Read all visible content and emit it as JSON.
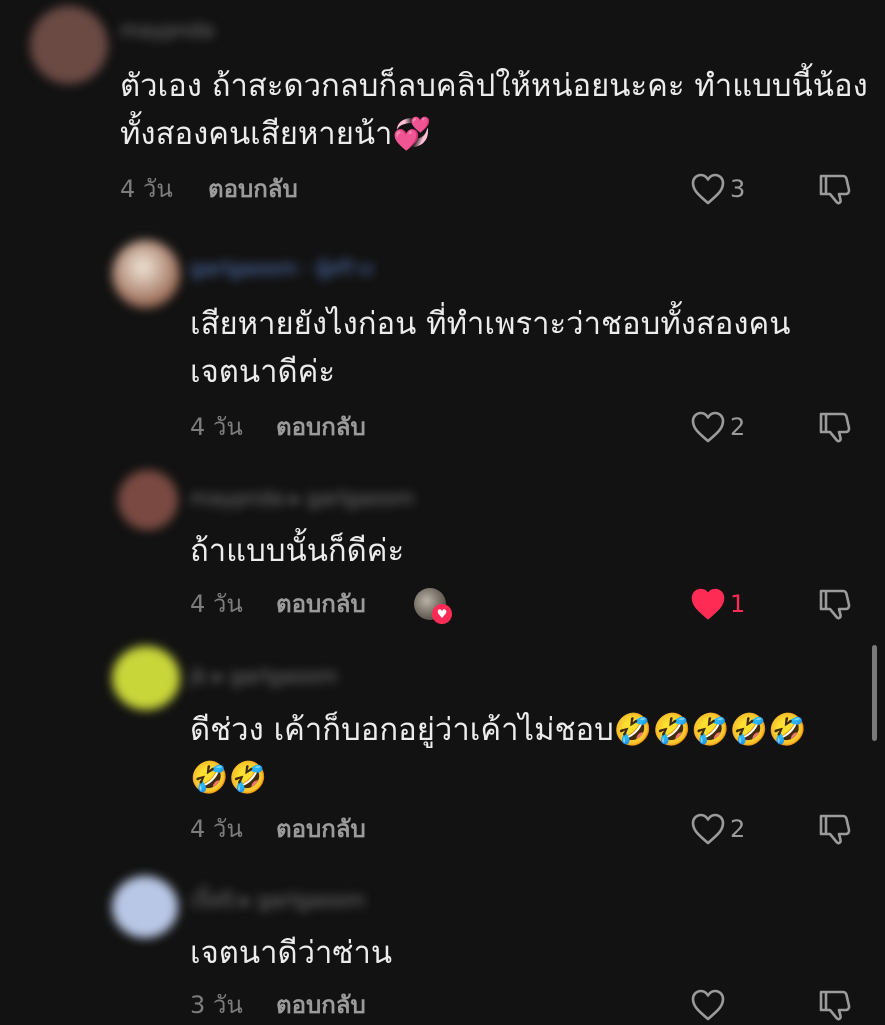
{
  "comments": [
    {
      "username": "maypnda",
      "lines": [
        "ตัวเอง ถ้าสะดวกลบก็ลบคลิปให้หน่อยนะคะ ทำแบบนี้น้อง",
        "ทั้งสองคนเสียหายน้า💞"
      ],
      "time": "4 วัน",
      "reply": "ตอบกลับ",
      "likes": "3",
      "liked": false,
      "avatar_color": "#6b4a44"
    },
    {
      "username": "garlgaoom · ผู้สร้าง",
      "lines": [
        "เสียหายยังไงก่อน ที่ทำเพราะว่าชอบทั้งสองคน",
        "เจตนาดีค่ะ"
      ],
      "time": "4 วัน",
      "reply": "ตอบกลับ",
      "likes": "2",
      "liked": false,
      "avatar_color": "#9a6a55"
    },
    {
      "username": "maypnda ▸ garlgaoom",
      "lines": [
        "ถ้าแบบนั้นก็ดีค่ะ"
      ],
      "time": "4 วัน",
      "reply": "ตอบกลับ",
      "likes": "1",
      "liked": true,
      "avatar_color": "#7a4a42"
    },
    {
      "username": "jk ▸ garlgaoom",
      "lines": [
        "ดีช่วง เค้าก็บอกอยู่ว่าเค้าไม่ชอบ🤣🤣🤣🤣🤣",
        "🤣🤣"
      ],
      "time": "4 วัน",
      "reply": "ตอบกลับ",
      "likes": "2",
      "liked": false,
      "avatar_color": "#c9d63a"
    },
    {
      "username": "เปิ้ลปิ ▸ garlgaoom",
      "lines": [
        "เจตนาดีว่าซ่าน"
      ],
      "time": "3 วัน",
      "reply": "ตอบกลับ",
      "likes": "",
      "liked": false,
      "avatar_color": "#b9c7e6"
    }
  ],
  "colors": {
    "background": "#121212",
    "text": "#ececec",
    "meta": "#7d7d7d",
    "like_red": "#fe2c55"
  },
  "icons": {
    "like": "heart-outline-icon",
    "liked": "heart-filled-icon",
    "dislike": "thumbs-down-icon"
  }
}
